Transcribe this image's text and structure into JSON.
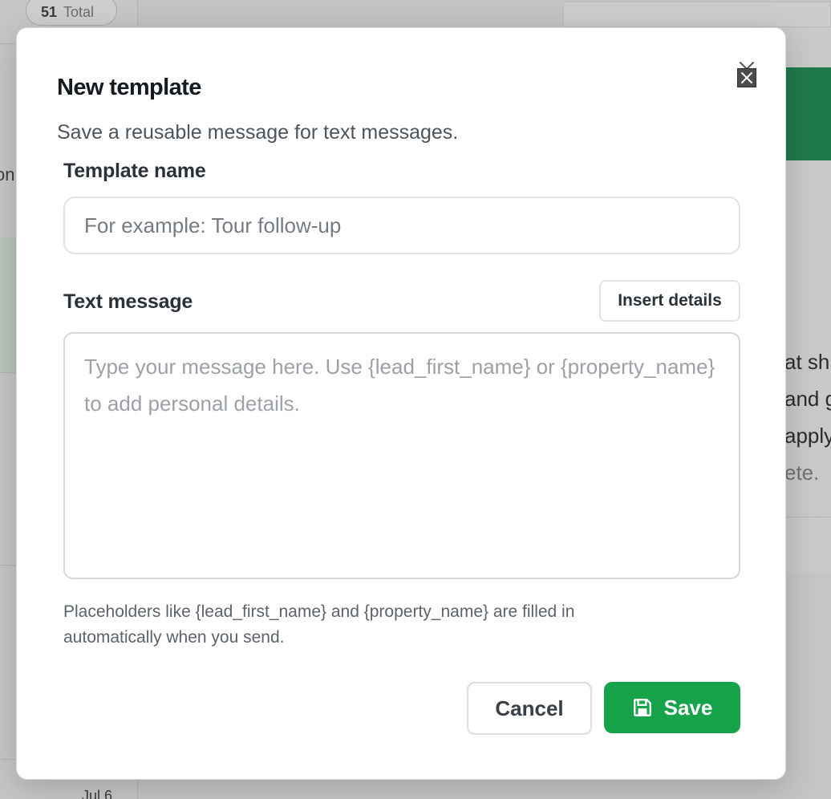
{
  "background": {
    "total_count": "51",
    "total_label": "Total",
    "left_fragment": "on",
    "date_fragment": "Jul 6",
    "right_fragments": [
      "at sh",
      "and g",
      "apply",
      "ete."
    ]
  },
  "modal": {
    "title": "New template",
    "subtitle": "Save a reusable message for text messages.",
    "template_name": {
      "label": "Template name",
      "value": "",
      "placeholder": "For example: Tour follow-up"
    },
    "text_message": {
      "label": "Text message",
      "value": "",
      "placeholder": "Type your message here. Use {lead_first_name} or {property_name} to add personal details."
    },
    "insert_details_label": "Insert details",
    "help_text": "Placeholders like {lead_first_name} and {property_name} are filled in automatically when you send.",
    "cancel_label": "Cancel",
    "save_label": "Save",
    "close_icon": "close-icon",
    "save_icon": "save-icon"
  },
  "colors": {
    "primary_green": "#16a34a",
    "overlay_grey": "#c4c6c5"
  }
}
